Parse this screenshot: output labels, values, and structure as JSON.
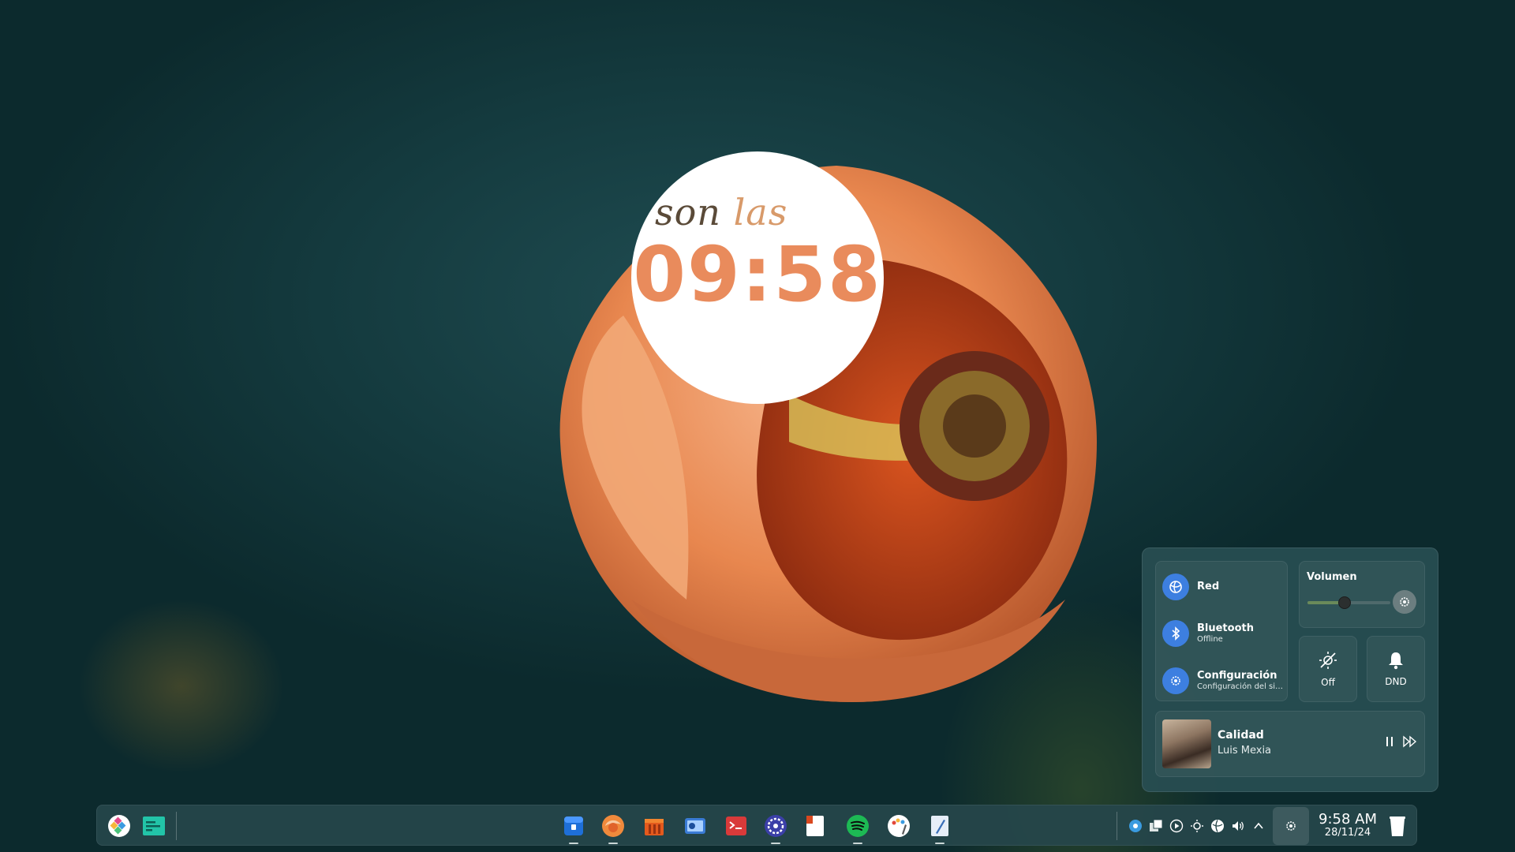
{
  "desktop": {
    "clock_widget": {
      "prefix": "son las",
      "time": "09:58"
    }
  },
  "quick_settings": {
    "network": {
      "title": "Red"
    },
    "bluetooth": {
      "title": "Bluetooth",
      "status": "Offline"
    },
    "settings": {
      "title": "Configuración",
      "subtitle": "Configuración del sis..."
    },
    "volume": {
      "label": "Volumen",
      "level": 0.45
    },
    "tiles": [
      {
        "label": "Off",
        "icon": "brightness-off-icon"
      },
      {
        "label": "DND",
        "icon": "bell-icon"
      }
    ],
    "media": {
      "title": "Calidad",
      "artist": "Luis Mexia"
    }
  },
  "taskbar": {
    "left_icons": [
      "app-launcher-icon",
      "task-manager-icon"
    ],
    "pinned_apps": [
      "file-manager-icon",
      "browser-icon",
      "package-store-icon",
      "image-viewer-icon",
      "terminal-icon",
      "system-settings-icon",
      "notes-icon",
      "spotify-icon",
      "paint-icon",
      "text-editor-icon"
    ],
    "tray_icons": [
      "kde-connect-icon",
      "windows-icon",
      "media-play-icon",
      "brightness-icon",
      "network-globe-icon",
      "volume-icon",
      "chevron-up-icon"
    ],
    "clock": {
      "time": "9:58 AM",
      "date": "28/11/24"
    }
  },
  "colors": {
    "accent": "#3d7fe0",
    "clock_text": "#e98b5c",
    "spotify": "#1db954"
  }
}
